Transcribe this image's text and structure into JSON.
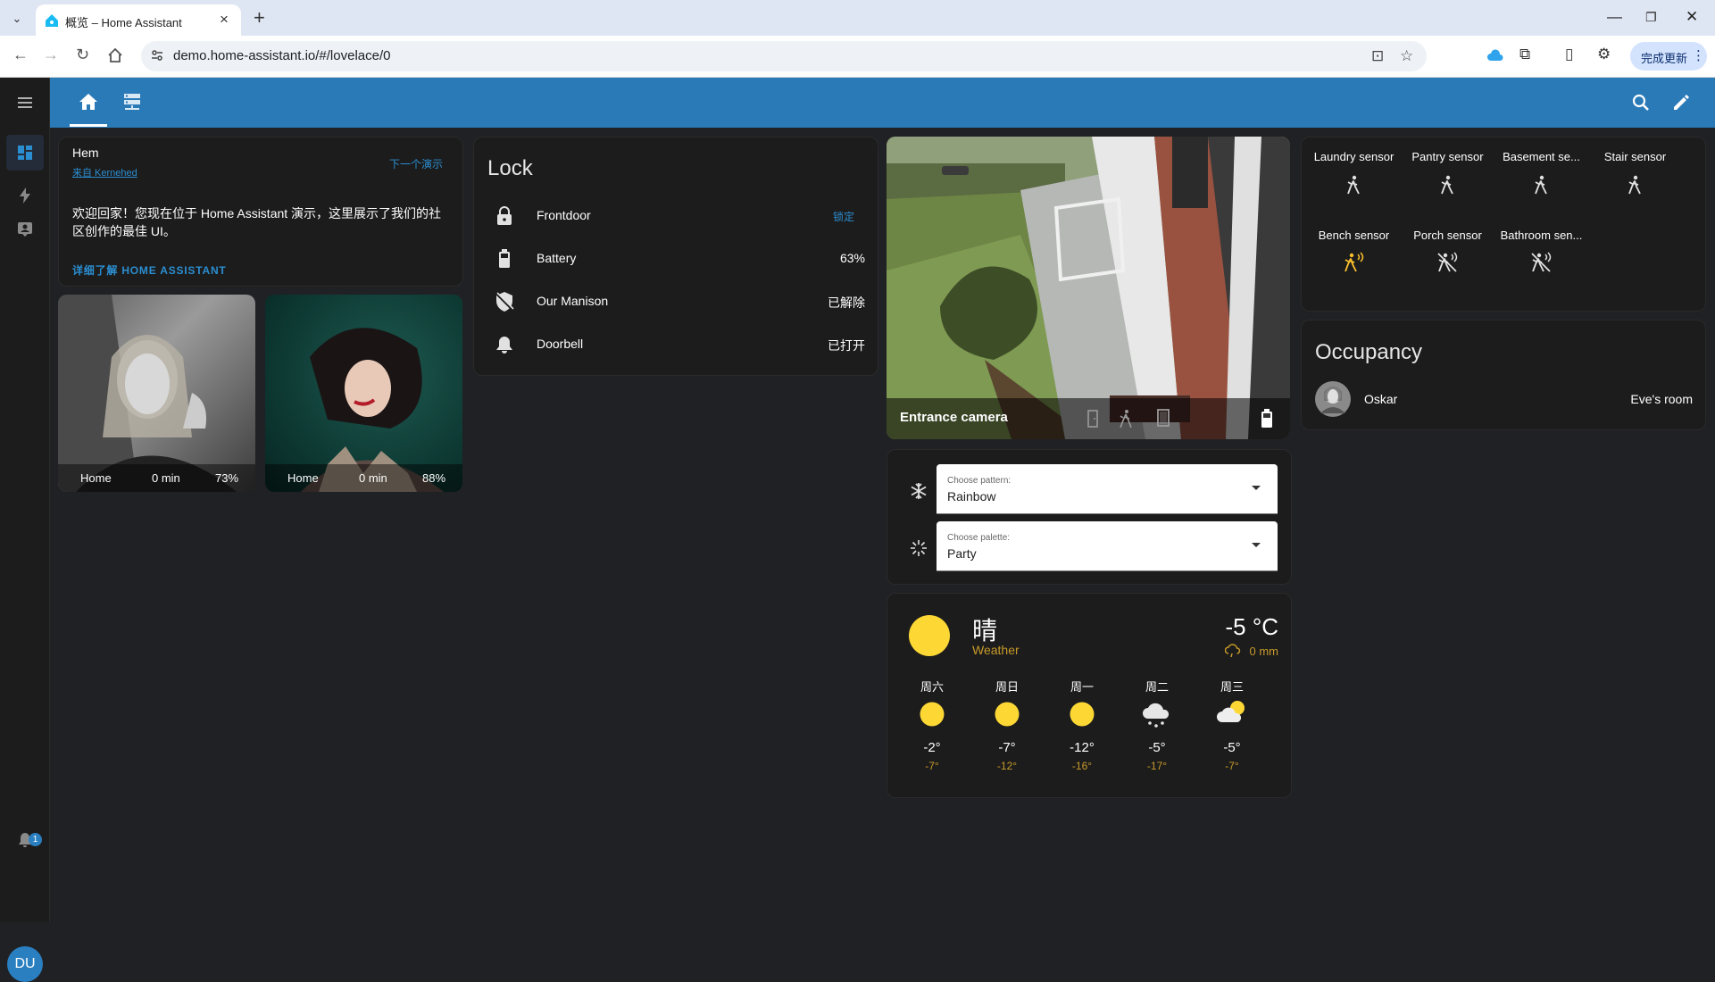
{
  "browser": {
    "tab_title": "概览 – Home Assistant",
    "url": "demo.home-assistant.io/#/lovelace/0",
    "update_label": "完成更新"
  },
  "sidebar": {
    "notification_count": "1",
    "user_initials": "DU"
  },
  "markdown_card": {
    "title": "Hem",
    "source": "来自 Kernehed",
    "next_demo": "下一个演示",
    "body": "欢迎回家！您现在位于 Home Assistant 演示，这里展示了我们的社区创作的最佳 UI。",
    "learn_more": "详细了解 HOME ASSISTANT"
  },
  "person_cards": [
    {
      "location": "Home",
      "duration": "0 min",
      "battery": "73%"
    },
    {
      "location": "Home",
      "duration": "0 min",
      "battery": "88%"
    }
  ],
  "lock_card": {
    "title": "Lock",
    "rows": [
      {
        "name": "Frontdoor",
        "state": "锁定",
        "icon": "lock-icon"
      },
      {
        "name": "Battery",
        "state": "63%",
        "icon": "battery-icon"
      },
      {
        "name": "Our Manison",
        "state": "已解除",
        "icon": "shield-off-icon"
      },
      {
        "name": "Doorbell",
        "state": "已打开",
        "icon": "bell-icon"
      }
    ]
  },
  "camera_card": {
    "title": "Entrance camera"
  },
  "select_card": {
    "pattern_label": "Choose pattern:",
    "pattern_value": "Rainbow",
    "palette_label": "Choose palette:",
    "palette_value": "Party"
  },
  "weather_card": {
    "condition": "晴",
    "name": "Weather",
    "temperature": "-5 °C",
    "precipitation": "0 mm",
    "forecast": [
      {
        "day": "周六",
        "high": "-2°",
        "low": "-7°",
        "icon": "sun-icon"
      },
      {
        "day": "周日",
        "high": "-7°",
        "low": "-12°",
        "icon": "sun-icon"
      },
      {
        "day": "周一",
        "high": "-12°",
        "low": "-16°",
        "icon": "sun-icon"
      },
      {
        "day": "周二",
        "high": "-5°",
        "low": "-17°",
        "icon": "snow-cloud-icon"
      },
      {
        "day": "周三",
        "high": "-5°",
        "low": "-7°",
        "icon": "partly-cloudy-icon"
      }
    ]
  },
  "sensor_card": {
    "sensors": [
      {
        "name": "Laundry sensor",
        "state": "clear"
      },
      {
        "name": "Pantry sensor",
        "state": "clear"
      },
      {
        "name": "Basement se...",
        "state": "clear"
      },
      {
        "name": "Stair sensor",
        "state": "clear"
      },
      {
        "name": "Bench sensor",
        "state": "detected"
      },
      {
        "name": "Porch sensor",
        "state": "off"
      },
      {
        "name": "Bathroom sen...",
        "state": "off"
      }
    ]
  },
  "occupancy_card": {
    "title": "Occupancy",
    "person": "Oskar",
    "room": "Eve's room"
  },
  "colors": {
    "header": "#2b7ab8",
    "accent": "#2b8ed1",
    "sun": "#fdd835",
    "motion_active": "#fbc02d"
  }
}
